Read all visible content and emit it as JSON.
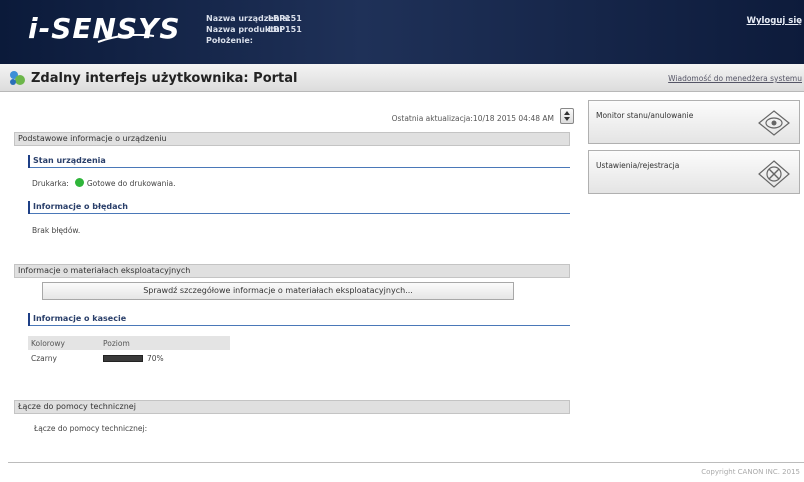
{
  "header": {
    "logo": "i-SENSYS",
    "device_name_label": "Nazwa urządzenia:",
    "device_name": "LBP151",
    "product_name_label": "Nazwa produktu:",
    "product_name": "LBP151",
    "location_label": "Położenie:",
    "location": "",
    "logout": "Wyloguj się"
  },
  "subheader": {
    "title": "Zdalny interfejs użytkownika: Portal",
    "sysmsg": "Wiadomość do menedżera systemu"
  },
  "main": {
    "last_update": "Ostatnia aktualizacja:10/18 2015 04:48 AM",
    "basic_info": {
      "title": "Podstawowe informacje o urządzeniu",
      "status_title": "Stan urządzenia",
      "printer_label": "Drukarka:",
      "printer_status": "Gotowe do drukowania.",
      "status_color": "#2fb53a",
      "errors_title": "Informacje o błędach",
      "errors_text": "Brak błędów."
    },
    "consumables": {
      "title": "Informacje o materiałach eksploatacyjnych",
      "detail_button": "Sprawdź szczegółowe informacje o materiałach eksploatacyjnych...",
      "cartridge_title": "Informacje o kasecie",
      "table": {
        "headers": [
          "Kolorowy",
          "Poziom"
        ],
        "rows": [
          {
            "color": "Czarny",
            "level": "70%",
            "level_value": 0.7
          }
        ]
      }
    },
    "support": {
      "title": "Łącze do pomocy technicznej",
      "link": "Łącze do pomocy technicznej:"
    }
  },
  "sidebar": {
    "monitor": "Monitor stanu/anulowanie",
    "settings": "Ustawienia/rejestracja"
  },
  "footer": {
    "copyright": "Copyright CANON INC. 2015"
  }
}
